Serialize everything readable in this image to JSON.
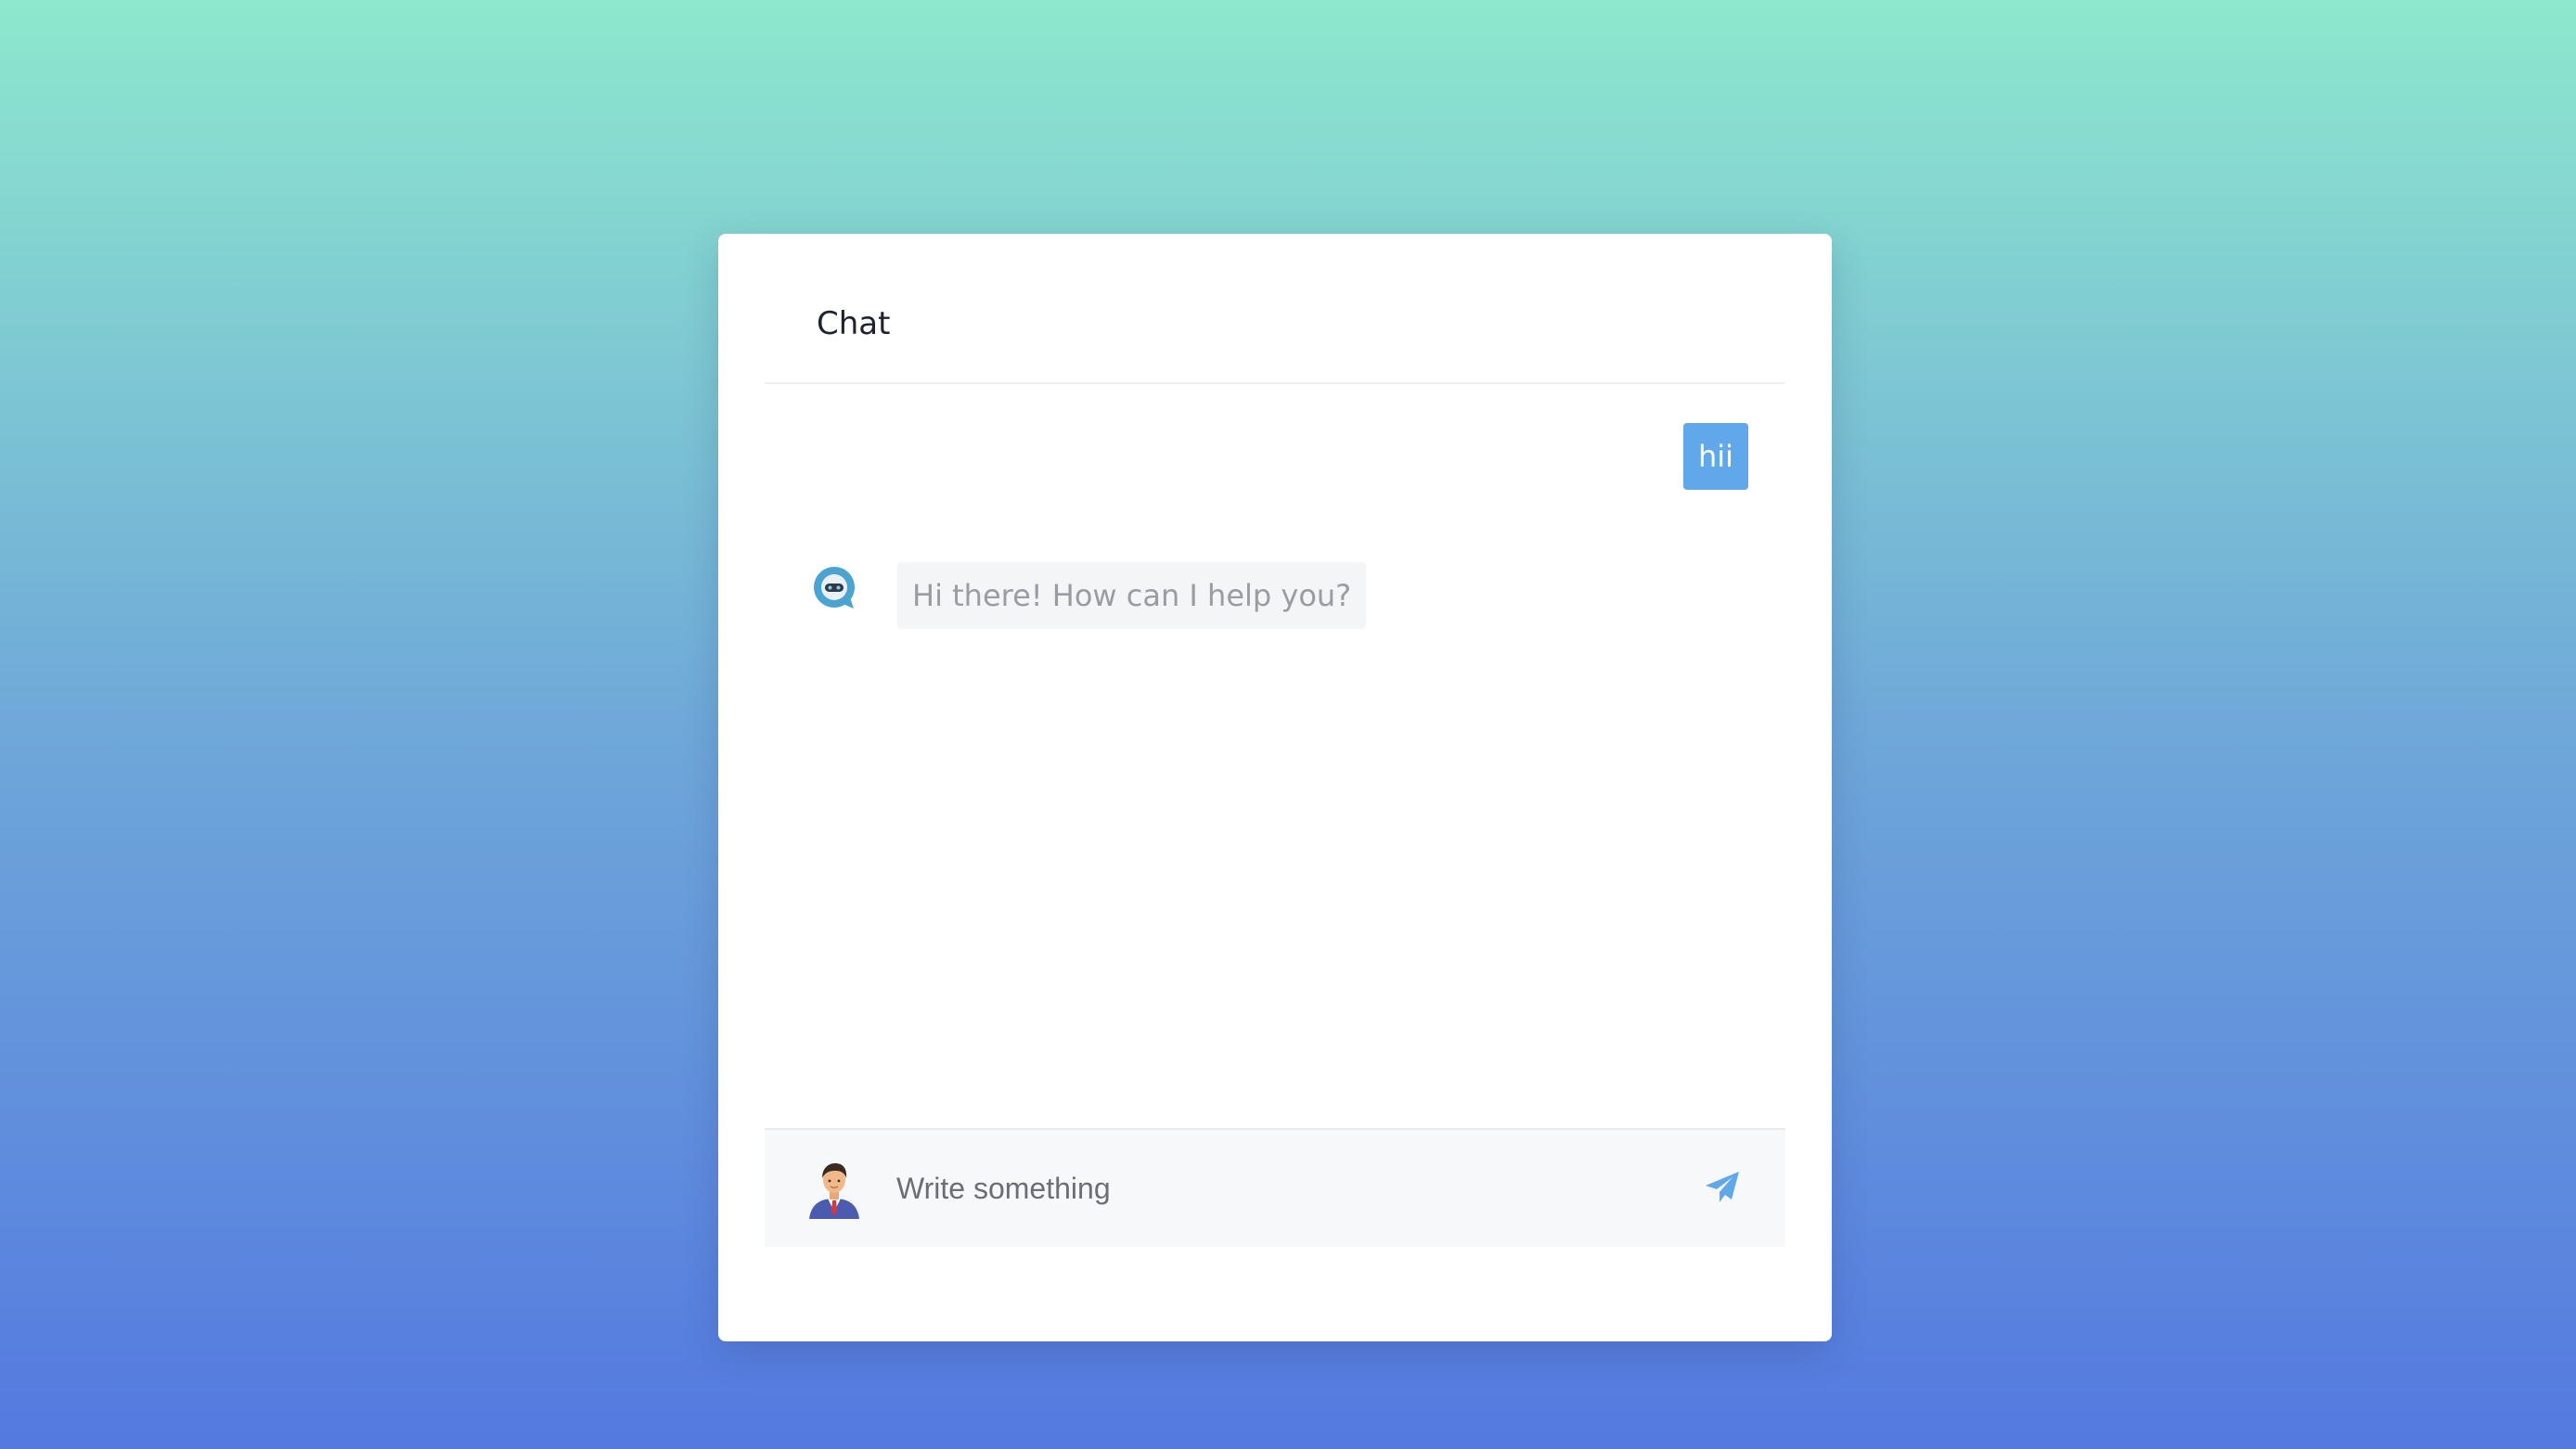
{
  "header": {
    "title": "Chat"
  },
  "messages": [
    {
      "sender": "user",
      "text": "hii"
    },
    {
      "sender": "bot",
      "text": "Hi there! How can I help you?"
    }
  ],
  "composer": {
    "placeholder": "Write something",
    "value": ""
  },
  "icons": {
    "bot_avatar": "chatbot-bubble-icon",
    "user_avatar": "businessman-avatar",
    "send": "paper-plane-icon"
  },
  "colors": {
    "accent": "#60a8ea",
    "bot_bubble": "#f4f5f7",
    "bot_text": "#9a9ca3"
  }
}
